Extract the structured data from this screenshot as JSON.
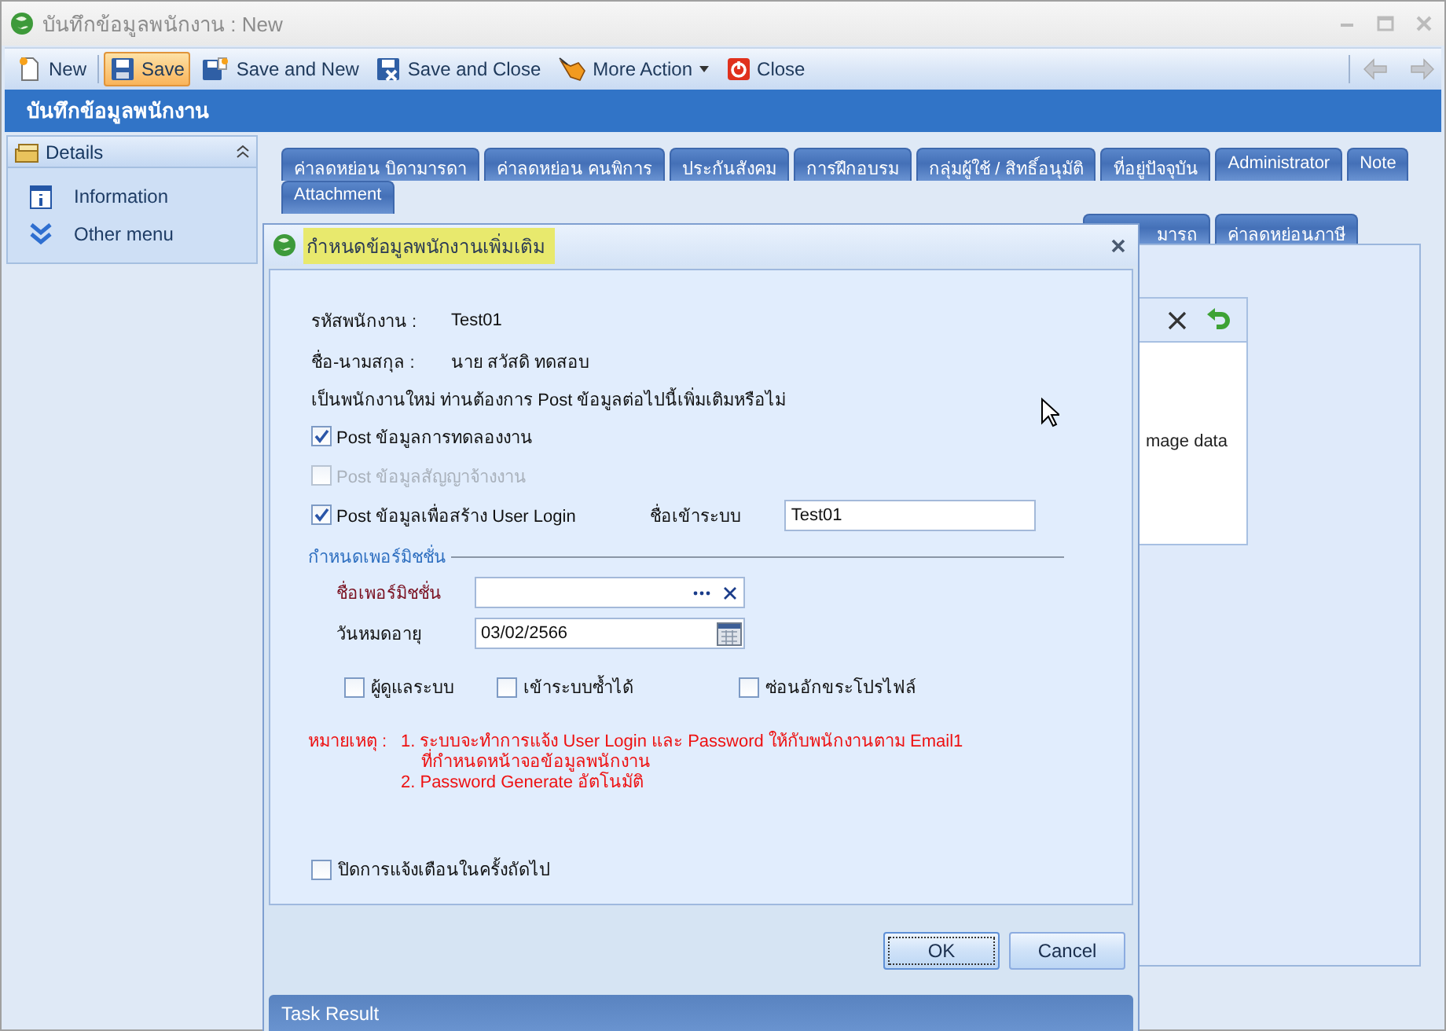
{
  "window": {
    "title": "บันทึกข้อมูลพนักงาน : New"
  },
  "toolbar": {
    "buttons": [
      {
        "label": "New",
        "kind": "button",
        "selected": false
      },
      {
        "label": "Save",
        "kind": "button",
        "selected": true
      },
      {
        "label": "Save and New",
        "kind": "button",
        "selected": false
      },
      {
        "label": "Save and Close",
        "kind": "button",
        "selected": false
      },
      {
        "label": "More Action",
        "kind": "dropdown",
        "selected": false
      },
      {
        "label": "Close",
        "kind": "button",
        "selected": false
      }
    ],
    "nav": [
      {
        "disabled": true
      },
      {
        "disabled": true
      }
    ]
  },
  "header": {
    "title": "บันทึกข้อมูลพนักงาน"
  },
  "sidebar": {
    "title": "Details",
    "expanded": true,
    "items": [
      {
        "label": "Information"
      },
      {
        "label": "Other menu"
      }
    ]
  },
  "tab_rows": [
    {
      "tabs": [
        {
          "label": "ค่าลดหย่อน บิดามารดา",
          "selected": false
        },
        {
          "label": "ค่าลดหย่อน คนพิการ",
          "selected": false
        },
        {
          "label": "ประกันสังคม",
          "selected": false
        },
        {
          "label": "การฝึกอบรม",
          "selected": false
        },
        {
          "label": "กลุ่มผู้ใช้ / สิทธิ์อนุมัติ",
          "selected": false
        },
        {
          "label": "ที่อยู่ปัจจุบัน",
          "selected": false
        },
        {
          "label": "Administrator",
          "selected": false
        },
        {
          "label": "Note",
          "selected": false
        }
      ]
    },
    {
      "tabs": [
        {
          "label": "Attachment",
          "selected": false
        }
      ]
    },
    {
      "tabs": [
        {
          "label": "มารถ",
          "selected": false
        },
        {
          "label": "ค่าลดหย่อนภาษี",
          "selected": false
        }
      ]
    }
  ],
  "side_panel": {
    "text": "mage data"
  },
  "dialog": {
    "title": "กำหนดข้อมูลพนักงานเพิ่มเติม",
    "fields": [
      {
        "label": "รหัสพนักงาน :",
        "value": "Test01"
      },
      {
        "label": "ชื่อ-นามสกุล :",
        "value": "นาย สวัสดิ ทดสอบ"
      }
    ],
    "question": "เป็นพนักงานใหม่ ท่านต้องการ Post ข้อมูลต่อไปนี้เพิ่มเติมหรือไม่",
    "post_options": [
      {
        "label": "Post ข้อมูลการทดลองงาน",
        "checked": true,
        "disabled": false
      },
      {
        "label": "Post ข้อมูลสัญญาจ้างงาน",
        "checked": false,
        "disabled": true
      },
      {
        "label": "Post ข้อมูลเพื่อสร้าง User Login",
        "checked": true,
        "disabled": false
      }
    ],
    "login": {
      "label": "ชื่อเข้าระบบ",
      "value": "Test01"
    },
    "permission": {
      "title": "กำหนดเพอร์มิชชั่น",
      "name_label": "ชื่อเพอร์มิชชั่น",
      "expiry_label": "วันหมดอายุ",
      "expiry_value": "03/02/2566",
      "options": [
        {
          "label": "ผู้ดูแลระบบ",
          "checked": false
        },
        {
          "label": "เข้าระบบซ้ำได้",
          "checked": false
        },
        {
          "label": "ซ่อนอักขระโปรไฟล์",
          "checked": false
        }
      ]
    },
    "note": {
      "label": "หมายเหตุ :",
      "items": [
        "1. ระบบจะทำการแจ้ง User Login และ Password ให้กับพนักงานตาม Email1\nที่กำหนดหน้าจอข้อมูลพนักงาน",
        "2. Password Generate อัตโนมัติ"
      ]
    },
    "dont_remind": {
      "label": "ปิดการแจ้งเตือนในครั้งถัดไป",
      "checked": false
    },
    "buttons": [
      {
        "label": "OK",
        "focused": true
      },
      {
        "label": "Cancel",
        "focused": false
      }
    ],
    "task_result": "Task Result"
  }
}
